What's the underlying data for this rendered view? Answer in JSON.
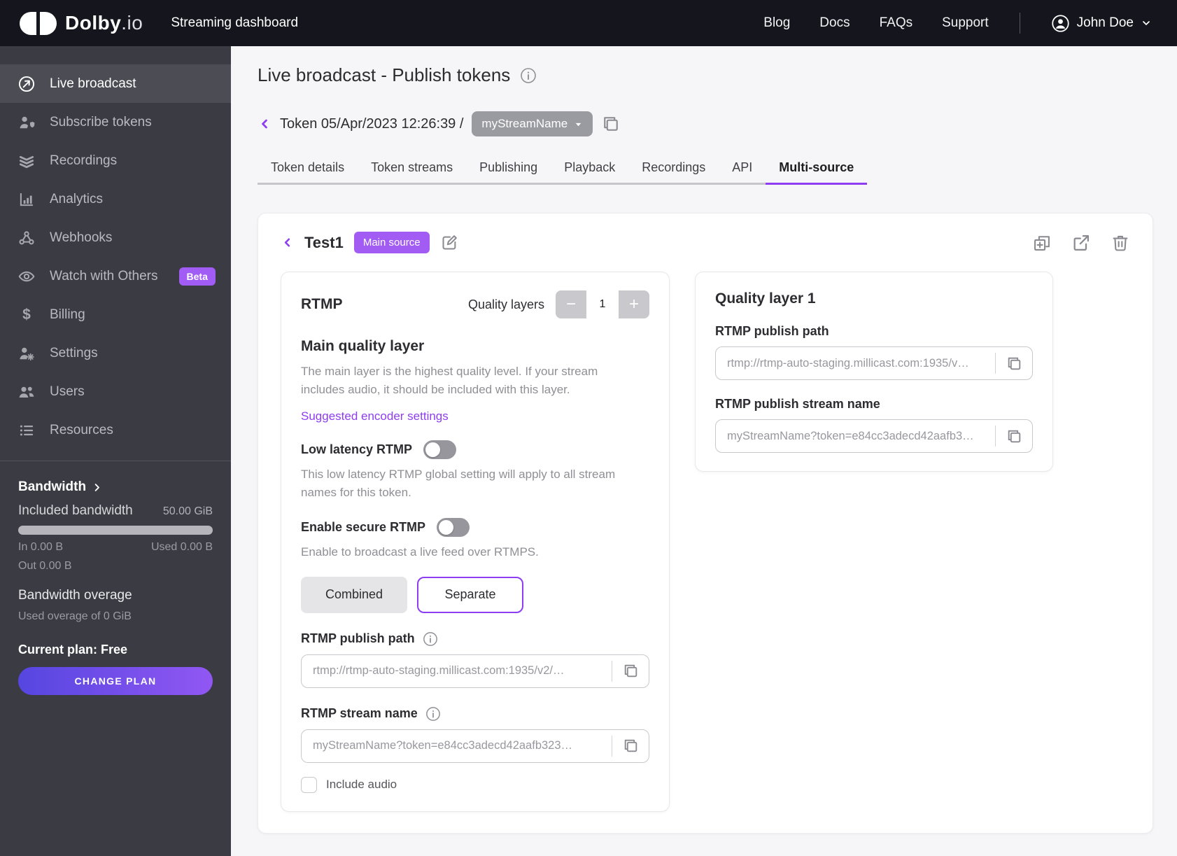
{
  "header": {
    "brand_main": "Dolby",
    "brand_suffix": ".io",
    "product": "Streaming dashboard",
    "nav": [
      {
        "label": "Blog"
      },
      {
        "label": "Docs"
      },
      {
        "label": "FAQs"
      },
      {
        "label": "Support"
      }
    ],
    "user_name": "John Doe"
  },
  "sidebar": {
    "items": [
      {
        "label": "Live broadcast",
        "active": true
      },
      {
        "label": "Subscribe tokens"
      },
      {
        "label": "Recordings"
      },
      {
        "label": "Analytics"
      },
      {
        "label": "Webhooks"
      },
      {
        "label": "Watch with Others",
        "badge": "Beta"
      },
      {
        "label": "Billing"
      },
      {
        "label": "Settings"
      },
      {
        "label": "Users"
      },
      {
        "label": "Resources"
      }
    ],
    "bandwidth": {
      "title": "Bandwidth",
      "included_label": "Included bandwidth",
      "included_value": "50.00 GiB",
      "in_value": "In 0.00 B",
      "used_value": "Used 0.00 B",
      "out_value": "Out 0.00 B",
      "overage_title": "Bandwidth overage",
      "overage_text": "Used overage of 0 GiB",
      "plan_text": "Current plan: Free",
      "change_plan_button": "CHANGE PLAN"
    }
  },
  "main": {
    "page_title": "Live broadcast - Publish tokens",
    "breadcrumb": {
      "token_label": "Token 05/Apr/2023 12:26:39 /",
      "stream_pill": "myStreamName"
    },
    "tabs": [
      {
        "label": "Token details"
      },
      {
        "label": "Token streams"
      },
      {
        "label": "Publishing"
      },
      {
        "label": "Playback"
      },
      {
        "label": "Recordings"
      },
      {
        "label": "API"
      },
      {
        "label": "Multi-source",
        "active": true
      }
    ],
    "panel": {
      "source_name": "Test1",
      "source_badge": "Main source",
      "rtmp_card": {
        "title": "RTMP",
        "quality_layers_label": "Quality layers",
        "quality_layers_value": "1",
        "section_title": "Main quality layer",
        "section_description": "The main layer is the highest quality level. If your stream includes audio, it should be included with this layer.",
        "encoder_link": "Suggested encoder settings",
        "low_latency_label": "Low latency RTMP",
        "low_latency_enabled": false,
        "low_latency_description": "This low latency RTMP global setting will apply to all stream names for this token.",
        "secure_label": "Enable secure RTMP",
        "secure_enabled": false,
        "secure_description": "Enable to broadcast a live feed over RTMPS.",
        "mode_combined": "Combined",
        "mode_separate": "Separate",
        "mode_selected": "Separate",
        "publish_path_label": "RTMP publish path",
        "publish_path_value": "rtmp://rtmp-auto-staging.millicast.com:1935/v2/…",
        "stream_name_label": "RTMP stream name",
        "stream_name_value": "myStreamName?token=e84cc3adecd42aafb323…",
        "include_audio_label": "Include audio",
        "include_audio_checked": false
      },
      "quality_card": {
        "title": "Quality layer 1",
        "publish_path_label": "RTMP publish path",
        "publish_path_value": "rtmp://rtmp-auto-staging.millicast.com:1935/v…",
        "stream_name_label": "RTMP publish stream name",
        "stream_name_value": "myStreamName?token=e84cc3adecd42aafb3…"
      }
    }
  },
  "colors": {
    "accent_purple": "#8E3DF0",
    "badge_purple": "#A35CF3",
    "beta_badge_purple": "#A05CF5",
    "plan_gradient_start": "#5646E0",
    "plan_gradient_end": "#9157F3",
    "header_bg": "#15151D",
    "sidebar_bg": "#3B3B43",
    "sidebar_active_bg": "#4C4C54",
    "page_bg": "#F6F6F8"
  }
}
